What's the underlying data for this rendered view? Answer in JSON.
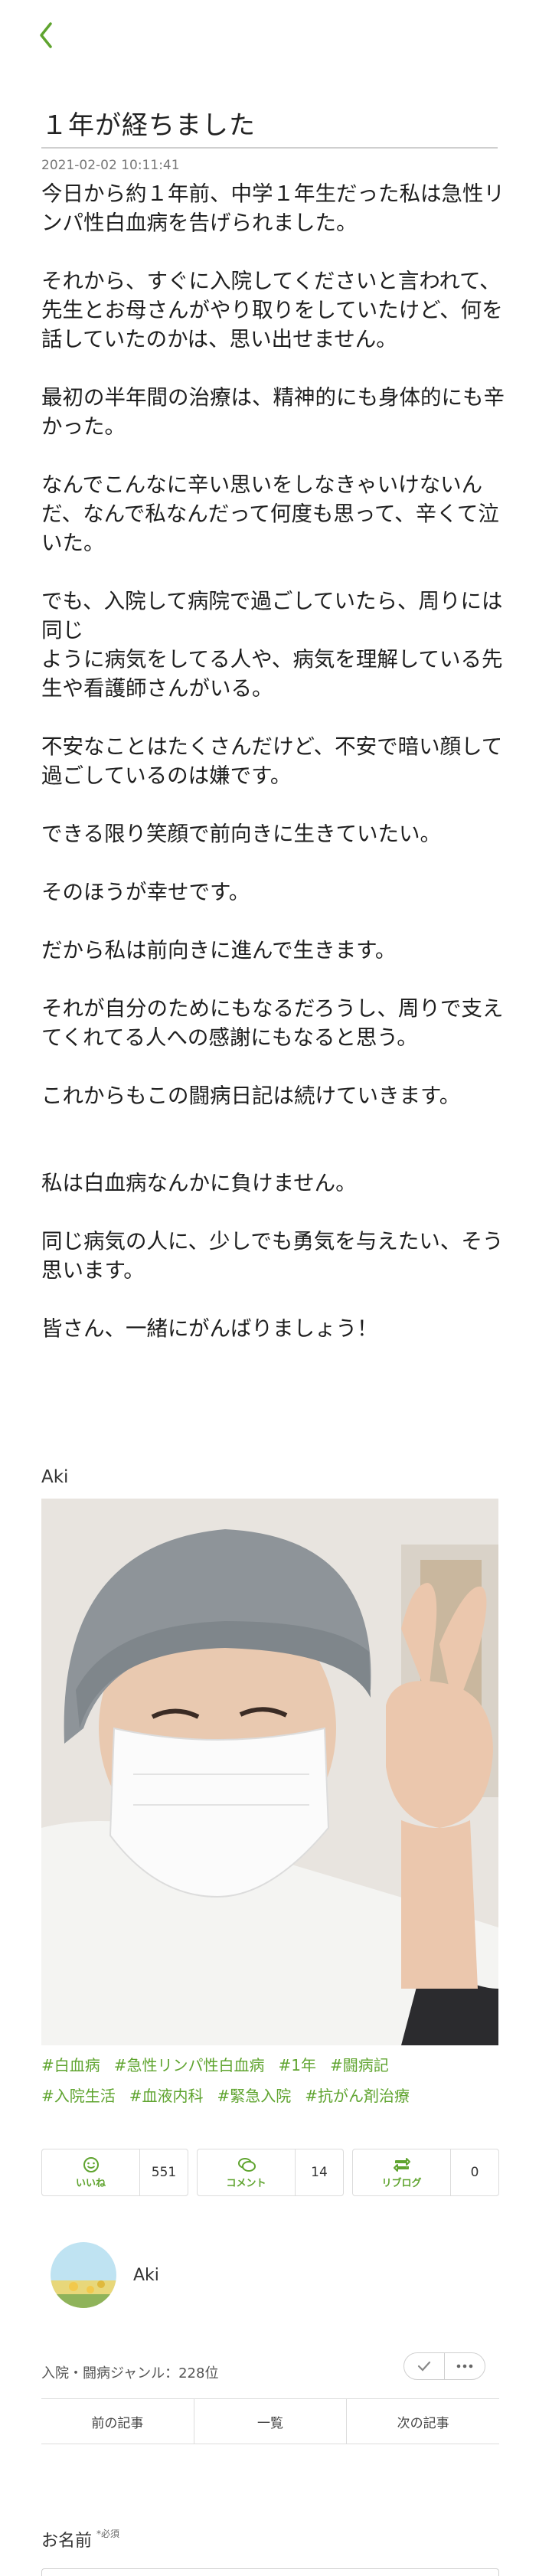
{
  "header": {
    "back_icon": "chevron-left-icon",
    "accent_color": "#5fa42f"
  },
  "post": {
    "title": "１年が経ちました",
    "date": "2021-02-02 10:11:41",
    "paragraphs": [
      "今日から約１年前、中学１年生だった私は急性リンパ性白血病を告げられました。",
      "それから、すぐに入院してくださいと言われて、先生とお母さんがやり取りをしていたけど、何を話していたのかは、思い出せません。",
      "最初の半年間の治療は、精神的にも身体的にも辛かった。",
      "なんでこんなに辛い思いをしなきゃいけないんだ、なんで私なんだって何度も思って、辛くて泣いた。",
      "でも、入院して病院で過ごしていたら、周りには同じ\nように病気をしてる人や、病気を理解している先生や看護師さんがいる。",
      "不安なことはたくさんだけど、不安で暗い顔して過ごしているのは嫌です。",
      "できる限り笑顔で前向きに生きていたい。",
      "そのほうが幸せです。",
      "だから私は前向きに進んで生きます。",
      "それが自分のためにもなるだろうし、周りで支えてくれてる人への感謝にもなると思う。",
      "これからもこの闘病日記は続けていきます。",
      "私は白血病なんかに負けません。",
      "同じ病気の人に、少しでも勇気を与えたい、そう思います。",
      "皆さん、一緒にがんばりましょう！"
    ],
    "signature": "Aki",
    "tags": [
      "#白血病",
      "#急性リンパ性白血病",
      "#1年",
      "#闘病記",
      "#入院生活",
      "#血液内科",
      "#緊急入院",
      "#抗がん剤治療"
    ]
  },
  "actions": [
    {
      "label": "いいね",
      "count": "551",
      "icon": "smile-icon"
    },
    {
      "label": "コメント",
      "count": "14",
      "icon": "comment-icon"
    },
    {
      "label": "リブログ",
      "count": "0",
      "icon": "reblog-icon"
    }
  ],
  "author": {
    "name": "Aki"
  },
  "ranking": {
    "text": "入院・闘病ジャンル：228位"
  },
  "pager": {
    "prev": "前の記事",
    "list": "一覧",
    "next": "次の記事"
  },
  "comment_form": {
    "name_label": "お名前",
    "required": "必須"
  }
}
